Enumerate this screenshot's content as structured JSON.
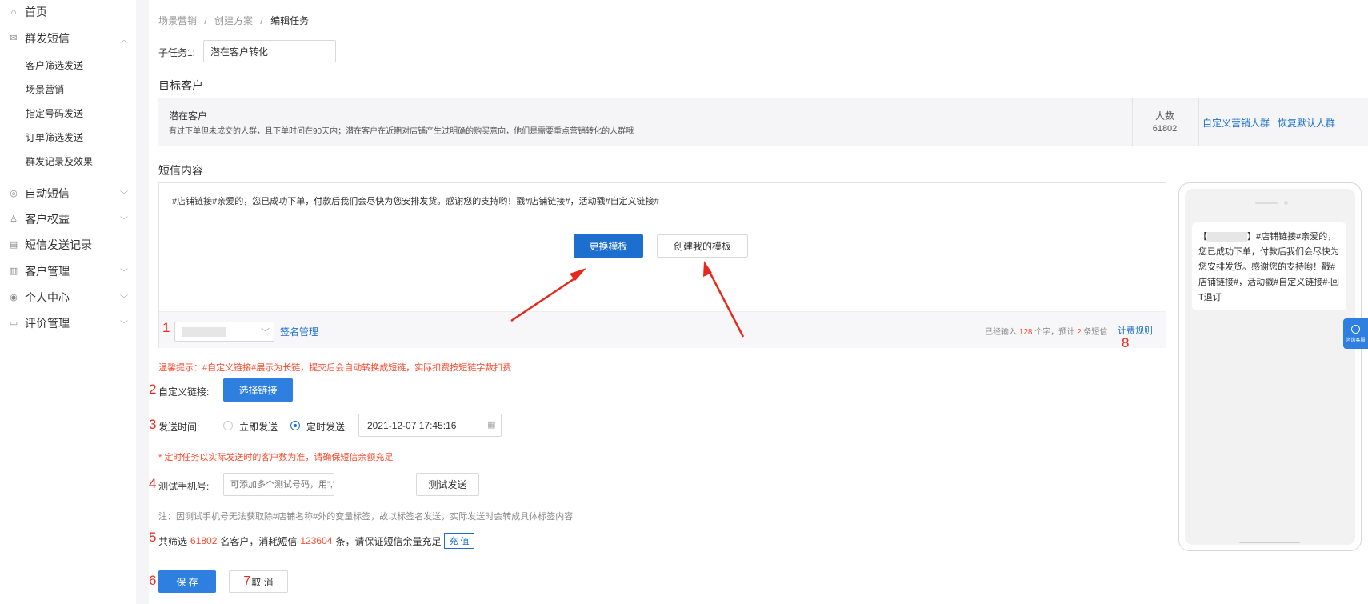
{
  "sidebar": {
    "items": [
      {
        "label": "首页",
        "icon": "home-icon"
      },
      {
        "label": "群发短信",
        "icon": "mail-icon",
        "expanded": true
      },
      {
        "label": "自动短信",
        "icon": "auto-icon"
      },
      {
        "label": "客户权益",
        "icon": "user-icon"
      },
      {
        "label": "短信发送记录",
        "icon": "record-icon"
      },
      {
        "label": "客户管理",
        "icon": "customer-icon"
      },
      {
        "label": "个人中心",
        "icon": "person-icon"
      },
      {
        "label": "评价管理",
        "icon": "review-icon"
      }
    ],
    "submenu": [
      "客户筛选发送",
      "场景营销",
      "指定号码发送",
      "订单筛选发送",
      "群发记录及效果"
    ]
  },
  "breadcrumb": {
    "items": [
      "场景营销",
      "创建方案"
    ],
    "current": "编辑任务",
    "separator": "/"
  },
  "subtask": {
    "label": "子任务1:",
    "value": "潜在客户转化"
  },
  "target": {
    "title": "目标客户",
    "name": "潜在客户",
    "desc": "有过下单但未成交的人群，且下单时间在90天内；潜在客户在近期对店铺产生过明确的购买意向，他们是需要重点营销转化的人群哦",
    "count_label": "人数",
    "count": "61802",
    "custom_link": "自定义营销人群",
    "restore_link": "恢复默认人群"
  },
  "sms": {
    "title": "短信内容",
    "content": "#店铺链接#亲爱的，您已成功下单，付款后我们会尽快为您安排发货。感谢您的支持哟！戳#店铺链接#，活动戳#自定义链接#",
    "change_template": "更换模板",
    "create_template": "创建我的模板",
    "signature_manage": "签名管理",
    "stats_prefix": "已经输入",
    "char_count": "128",
    "stats_mid": "个字，预计",
    "msg_count": "2",
    "stats_suffix": "条短信",
    "billing_rule": "计费规则"
  },
  "tip": "温馨提示：#自定义链接#展示为长链，提交后会自动转换成短链，实际扣费按短链字数扣费",
  "custom_link": {
    "label": "自定义链接:",
    "button": "选择链接"
  },
  "send_time": {
    "label": "发送时间:",
    "options": [
      "立即发送",
      "定时发送"
    ],
    "selected": "定时发送",
    "datetime": "2021-12-07 17:45:16",
    "note": "* 定时任务以实际发送时的客户数为准，请确保短信余额充足"
  },
  "test_phone": {
    "label": "测试手机号:",
    "placeholder": "可添加多个测试号码，用\",\"隔开",
    "button": "测试发送",
    "note": "注：因测试手机号无法获取除#店铺名称#外的变量标签，故以标签名发送，实际发送时会转成具体标签内容"
  },
  "summary": {
    "prefix": "共筛选",
    "customers": "61802",
    "mid": "名客户，消耗短信",
    "sms_count": "123604",
    "suffix": "条，请保证短信余量充足",
    "recharge": "充 值"
  },
  "actions": {
    "save": "保 存",
    "cancel": "取 消"
  },
  "annotations": [
    "1",
    "2",
    "3",
    "4",
    "5",
    "6",
    "7",
    "8"
  ],
  "phone_preview": {
    "prefix": "【",
    "bracket_close": "】",
    "text": "#店铺链接#亲爱的，您已成功下单，付款后我们会尽快为您安排发货。感谢您的支持哟！戳#店铺链接#，活动戳#自定义链接#-回T退订"
  },
  "consult": {
    "label": "咨询客服"
  },
  "colors": {
    "primary": "#1d6fcf",
    "danger": "#ff4a2e",
    "annotation": "#e8281b"
  }
}
